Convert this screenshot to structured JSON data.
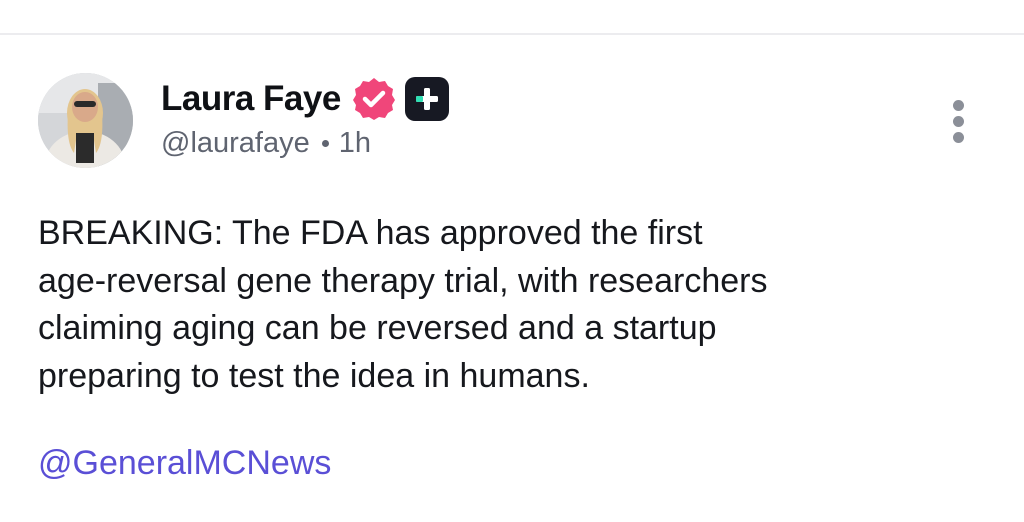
{
  "post": {
    "author": {
      "display_name": "Laura Faye",
      "handle": "@laurafaye",
      "time": "1h",
      "verified_icon": "verified-badge-icon",
      "plus_icon": "plus-badge-icon"
    },
    "text": "BREAKING: The FDA has approved the first\nage-reversal gene therapy trial, with researchers\nclaiming aging can be reversed and a startup\npreparing to test the idea in humans.",
    "mention": "@GeneralMCNews",
    "more_icon": "more-vertical-icon"
  },
  "colors": {
    "verified": "#f0467a",
    "plus_badge": "#171923",
    "plus_accent": "#2fe0b4",
    "mention": "#5a4fd6",
    "secondary_text": "#5f6470"
  }
}
